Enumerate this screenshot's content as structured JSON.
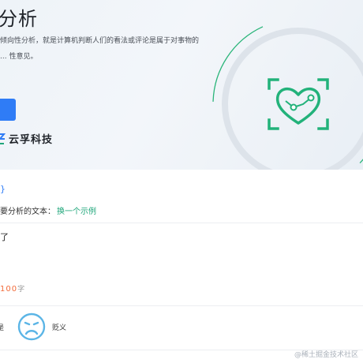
{
  "hero": {
    "title": "分析",
    "description": "倾向性分析，就是计算机判断人们的看法或评论是属于对事物的 ... 性意见。",
    "brand": "云孚科技"
  },
  "tabs": {
    "active_fragment": "}"
  },
  "prompt": {
    "label": "要分析的文本：",
    "example_link": "换一个示例"
  },
  "input": {
    "value": "了"
  },
  "counter": {
    "count": "100",
    "unit": "字"
  },
  "result": {
    "left_label": "是",
    "sentiment_label": "贬义",
    "sentiment_icon": "sad-face-icon"
  },
  "footer": {
    "watermark": "@稀土掘金技术社区"
  },
  "colors": {
    "accent_blue": "#2f7cf6",
    "accent_green": "#1fa67a",
    "counter_orange": "#f26b3a",
    "face_blue": "#5bb5e6"
  }
}
